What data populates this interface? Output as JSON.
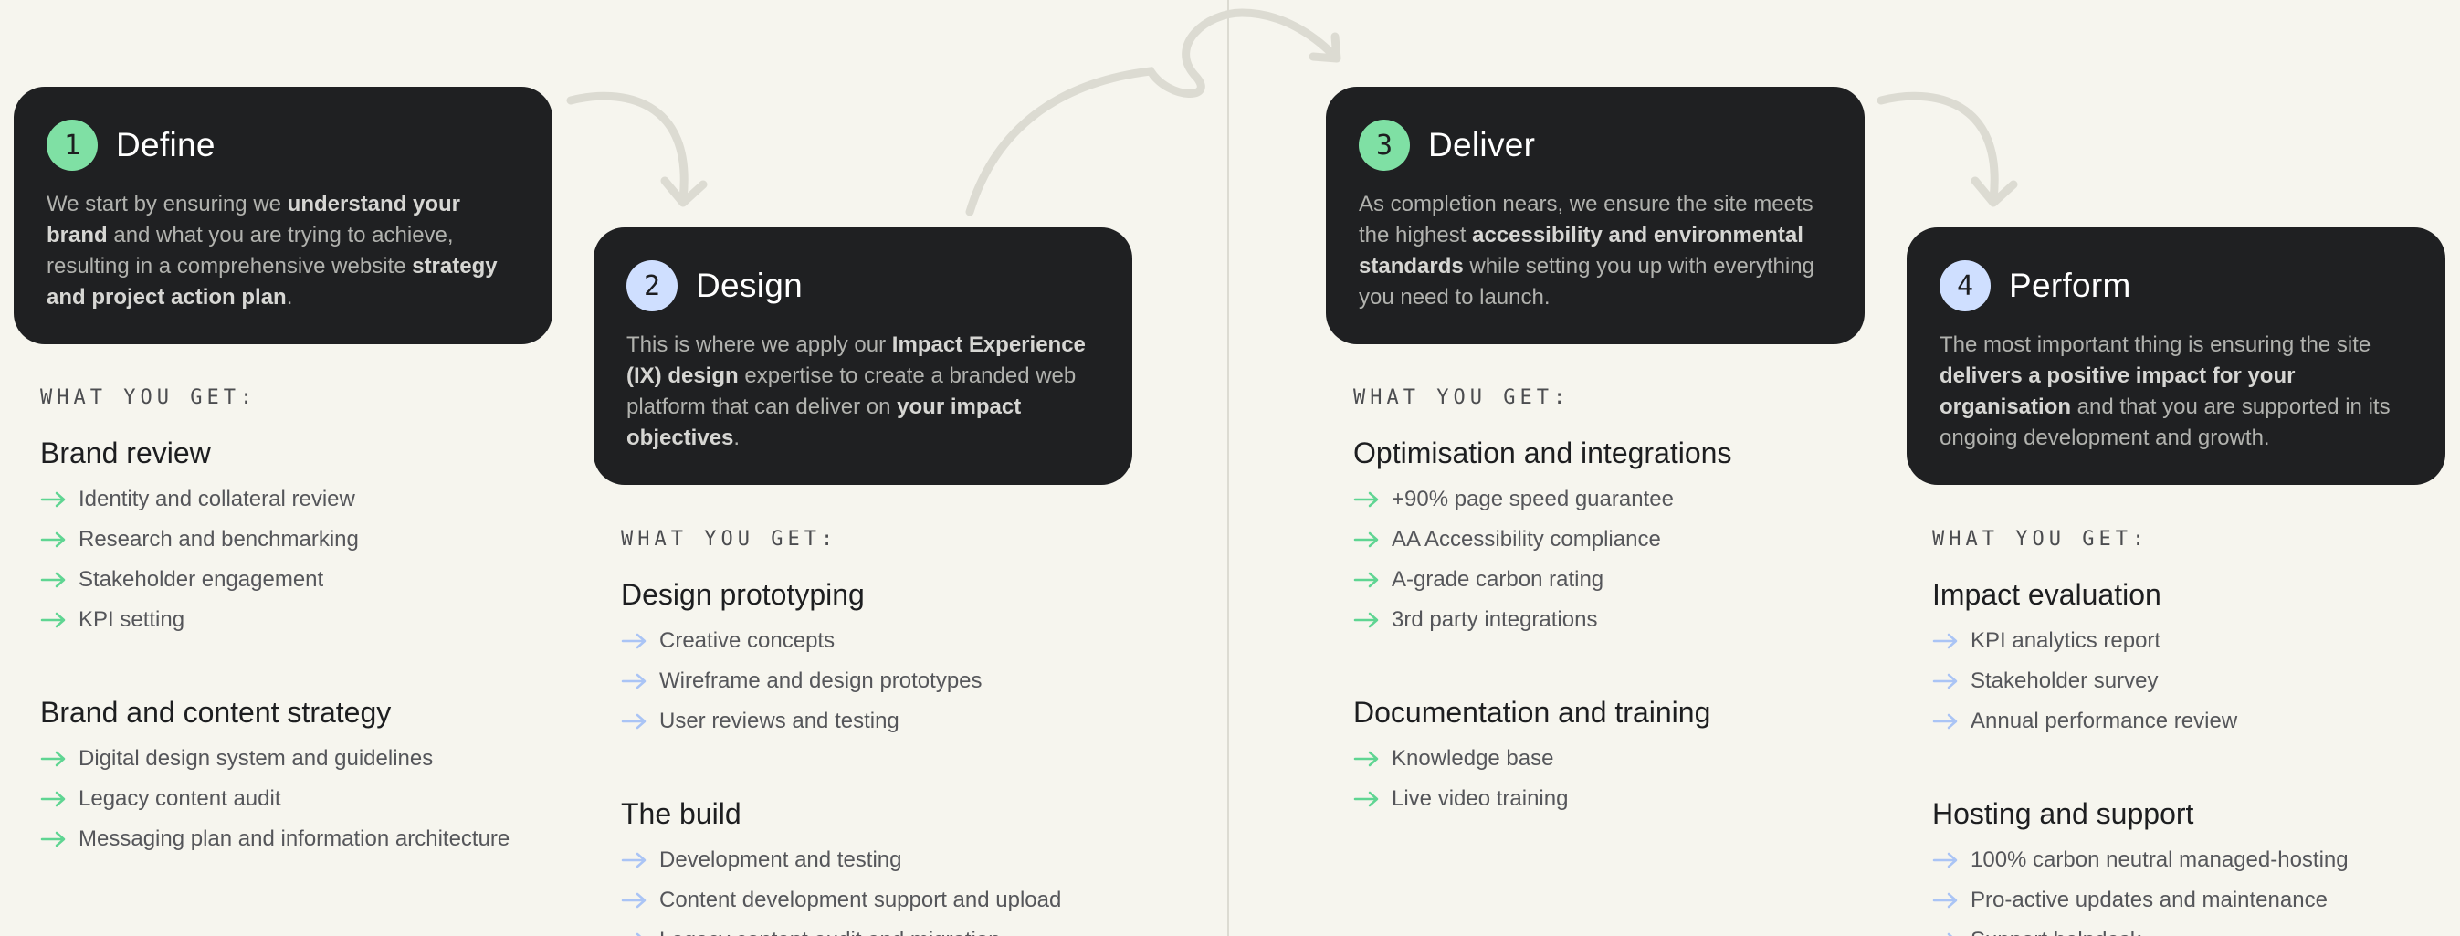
{
  "colors": {
    "background": "#f6f5ee",
    "card": "#1f2022",
    "accent_green": "#7fe0a4",
    "accent_blue": "#cfdfff",
    "arrow_green": "#5fd592",
    "arrow_blue": "#aac4f5"
  },
  "steps": [
    {
      "number": "1",
      "title": "Define",
      "badge_color": "green",
      "body": [
        {
          "text": "We start by ensuring we ",
          "bold": false
        },
        {
          "text": "understand your brand",
          "bold": true
        },
        {
          "text": " and what you are trying to achieve, resulting in a comprehensive website ",
          "bold": false
        },
        {
          "text": "strategy and project action plan",
          "bold": true
        },
        {
          "text": ".",
          "bold": false
        }
      ],
      "get_label": "WHAT YOU GET:",
      "sections": [
        {
          "title": "Brand review",
          "items": [
            "Identity and collateral review",
            "Research and benchmarking",
            "Stakeholder engagement",
            "KPI setting"
          ]
        },
        {
          "title": "Brand and content strategy",
          "items": [
            "Digital design system and guidelines",
            "Legacy content audit",
            "Messaging plan and information architecture"
          ]
        }
      ]
    },
    {
      "number": "2",
      "title": "Design",
      "badge_color": "blue",
      "body": [
        {
          "text": "This is where we apply our ",
          "bold": false
        },
        {
          "text": "Impact Experience (IX) design",
          "bold": true
        },
        {
          "text": " expertise to create a branded web platform that can deliver on ",
          "bold": false
        },
        {
          "text": "your impact objectives",
          "bold": true
        },
        {
          "text": ".",
          "bold": false
        }
      ],
      "get_label": "WHAT YOU GET:",
      "sections": [
        {
          "title": "Design prototyping",
          "items": [
            "Creative concepts",
            "Wireframe and design prototypes",
            "User reviews and testing"
          ]
        },
        {
          "title": "The build",
          "items": [
            "Development and testing",
            "Content development support and upload",
            "Legacy content audit and migration"
          ]
        }
      ]
    },
    {
      "number": "3",
      "title": "Deliver",
      "badge_color": "green",
      "body": [
        {
          "text": "As completion nears, we ensure the site meets the highest ",
          "bold": false
        },
        {
          "text": "accessibility and environmental standards",
          "bold": true
        },
        {
          "text": " while setting you up with everything you need to launch.",
          "bold": false
        }
      ],
      "get_label": "WHAT YOU GET:",
      "sections": [
        {
          "title": "Optimisation and integrations",
          "items": [
            "+90% page speed guarantee",
            "AA Accessibility compliance",
            "A-grade carbon rating",
            "3rd party integrations"
          ]
        },
        {
          "title": "Documentation and training",
          "items": [
            "Knowledge base",
            "Live video training"
          ]
        }
      ]
    },
    {
      "number": "4",
      "title": "Perform",
      "badge_color": "blue",
      "body": [
        {
          "text": "The most important thing is ensuring the site ",
          "bold": false
        },
        {
          "text": "delivers a positive impact for your organisation",
          "bold": true
        },
        {
          "text": " and that you are supported in its ongoing development and growth.",
          "bold": false
        }
      ],
      "get_label": "WHAT YOU GET:",
      "sections": [
        {
          "title": "Impact evaluation",
          "items": [
            "KPI analytics report",
            "Stakeholder survey",
            "Annual performance review"
          ]
        },
        {
          "title": "Hosting and support",
          "items": [
            "100% carbon neutral managed-hosting",
            "Pro-active updates and maintenance",
            "Support helpdesk"
          ]
        }
      ]
    }
  ]
}
